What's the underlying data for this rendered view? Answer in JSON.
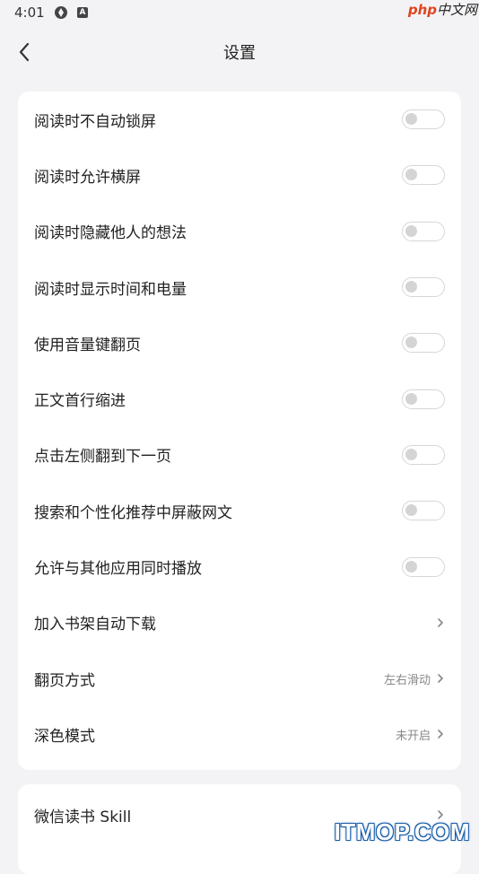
{
  "status_bar": {
    "time": "4:01",
    "icons": [
      "aperture-icon",
      "a-badge-icon"
    ]
  },
  "watermark_top": {
    "php": "php",
    "cn": "中文网"
  },
  "header": {
    "title": "设置",
    "back_icon": "chevron-left-icon"
  },
  "settings_main": [
    {
      "label": "阅读时不自动锁屏",
      "control": "toggle",
      "on": false
    },
    {
      "label": "阅读时允许横屏",
      "control": "toggle",
      "on": false
    },
    {
      "label": "阅读时隐藏他人的想法",
      "control": "toggle",
      "on": false
    },
    {
      "label": "阅读时显示时间和电量",
      "control": "toggle",
      "on": false
    },
    {
      "label": "使用音量键翻页",
      "control": "toggle",
      "on": false
    },
    {
      "label": "正文首行缩进",
      "control": "toggle",
      "on": false
    },
    {
      "label": "点击左侧翻到下一页",
      "control": "toggle",
      "on": false
    },
    {
      "label": "搜索和个性化推荐中屏蔽网文",
      "control": "toggle",
      "on": false
    },
    {
      "label": "允许与其他应用同时播放",
      "control": "toggle",
      "on": false
    },
    {
      "label": "加入书架自动下载",
      "control": "link",
      "value": ""
    },
    {
      "label": "翻页方式",
      "control": "link",
      "value": "左右滑动"
    },
    {
      "label": "深色模式",
      "control": "link",
      "value": "未开启"
    }
  ],
  "settings_second": [
    {
      "label": "微信读书 Skill",
      "control": "link",
      "value": ""
    }
  ],
  "watermark_bottom": "ITMOP.COM",
  "colors": {
    "background": "#f3f3f5",
    "card": "#ffffff",
    "toggle_off": "#d4d4d4"
  }
}
